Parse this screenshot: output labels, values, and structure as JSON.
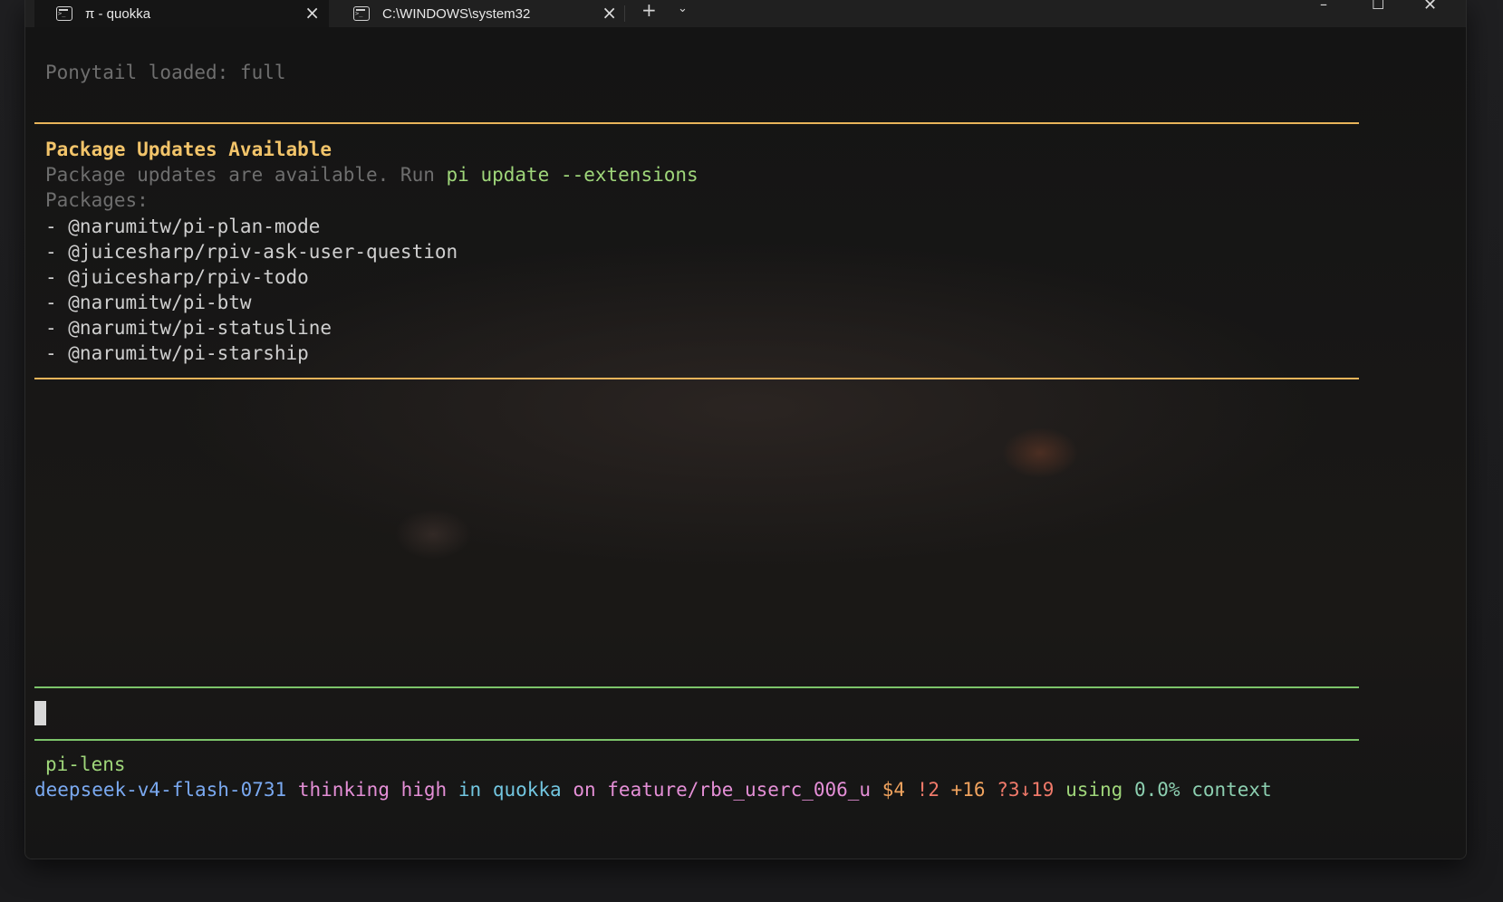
{
  "tabs": [
    {
      "label": "π - quokka",
      "active": true
    },
    {
      "label": "C:\\WINDOWS\\system32",
      "active": false
    }
  ],
  "tabbar": {
    "add_label": "+",
    "dropdown_label": "⌄"
  },
  "window_controls": {
    "minimize": "–",
    "maximize": "☐",
    "close": "✕"
  },
  "terminal": {
    "ponytail_line": "Ponytail loaded: full",
    "updates_title": "Package Updates Available",
    "updates_text": "Package updates are available. Run ",
    "updates_command": "pi update --extensions",
    "packages_label": "Packages:",
    "packages": [
      "- @narumitw/pi-plan-mode",
      "- @juicesharp/rpiv-ask-user-question",
      "- @juicesharp/rpiv-todo",
      "- @narumitw/pi-btw",
      "- @narumitw/pi-statusline",
      "- @narumitw/pi-starship"
    ],
    "footer_label": "pi-lens",
    "status": {
      "model": "deepseek-v4-flash-0731",
      "thinking": "thinking",
      "level": "high",
      "in_word": "in",
      "dir": "quokka",
      "on_word": "on",
      "branch": "feature/rbe_userc_006_u",
      "cost": "$4",
      "modified": "!2",
      "added": "+16",
      "untracked": "?3↓19",
      "using_word": "using",
      "context_pct": "0.0%",
      "context_word": "context"
    }
  },
  "colors": {
    "accent_rule_top": "#e8b45a",
    "accent_rule_input": "#7cc46a",
    "title_yellow": "#f2c46a",
    "command_green": "#9fd67a"
  }
}
